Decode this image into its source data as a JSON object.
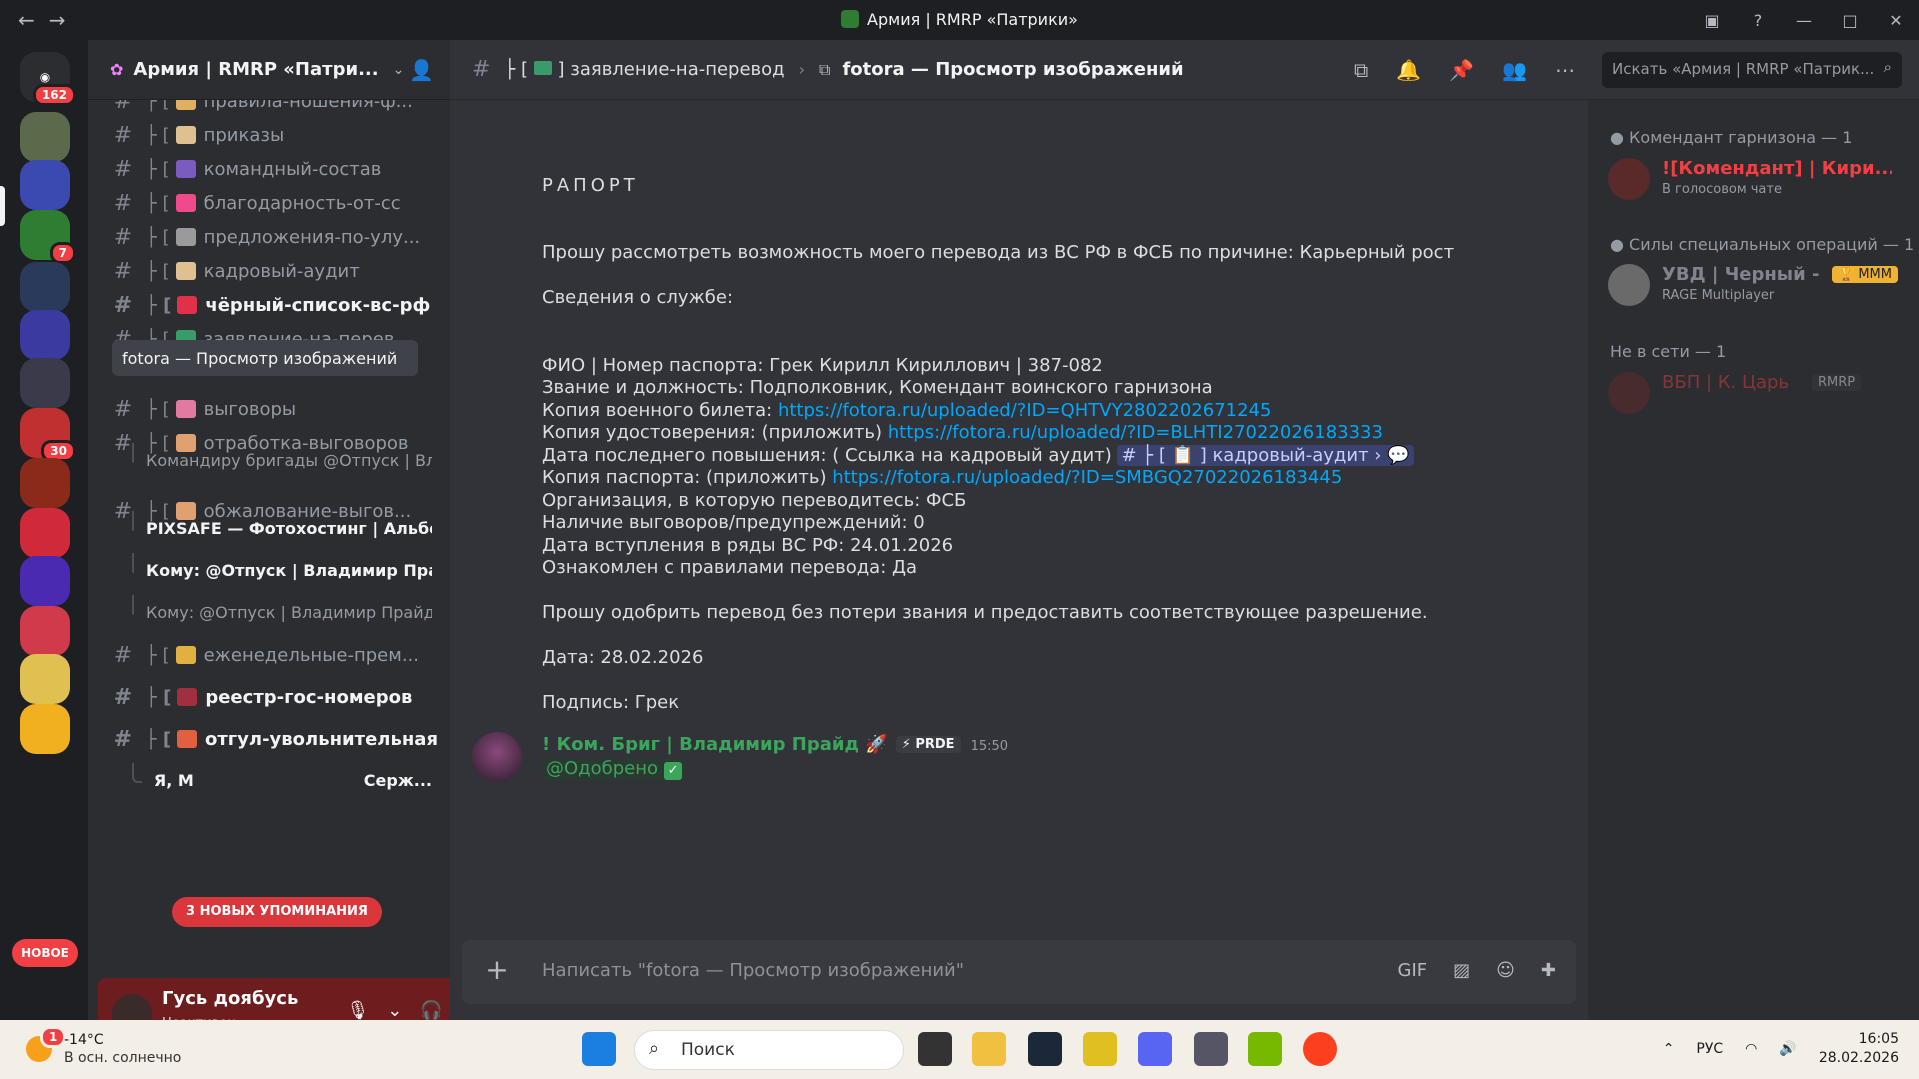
{
  "window": {
    "title": "Армия | RMRP «Патрики»"
  },
  "guilds": {
    "home_badge": "162",
    "badges": [
      "7",
      "30"
    ],
    "new_label": "НОВОЕ"
  },
  "server": {
    "name": "Армия | RMRP «Патри...",
    "mention_pill": "3 НОВЫХ УПОМИНАНИЯ"
  },
  "channels": [
    {
      "label": "правила-ношения-ф...",
      "emoji_color": "#e0b060"
    },
    {
      "label": "приказы",
      "emoji_color": "#e0c090"
    },
    {
      "label": "командный-состав",
      "emoji_color": "#7a5cc0"
    },
    {
      "label": "благодарность-от-сс",
      "emoji_color": "#f04a8a"
    },
    {
      "label": "предложения-по-улу...",
      "emoji_color": "#9a9a9a"
    },
    {
      "label": "кадровый-аудит",
      "emoji_color": "#e0c090"
    },
    {
      "label": "чёрный-список-вс-рф",
      "emoji_color": "#e0304a"
    },
    {
      "label": "заявление-на-перев...",
      "emoji_color": "#3a9a6a"
    },
    {
      "label": "выговоры",
      "emoji_color": "#e07aa0"
    },
    {
      "label": "отработка-выговоров",
      "emoji_color": "#e0a070"
    },
    {
      "label": "обжалование-выгов...",
      "emoji_color": "#e0a070"
    },
    {
      "label": "еженедельные-прем...",
      "emoji_color": "#e0b040"
    },
    {
      "label": "реестр-гос-номеров",
      "emoji_color": "#a03040"
    },
    {
      "label": "отгул-увольнительная",
      "emoji_color": "#e06040"
    }
  ],
  "threads": [
    {
      "label": "fotora — Просмотр изображений"
    },
    {
      "label": "Командиру бригады @Отпуск | Вл..."
    },
    {
      "label": "PIXSAFE — Фотохостинг | Альбом ..."
    },
    {
      "label": "Кому: @Отпуск | Владимир Прайд ..."
    },
    {
      "label": "Кому: @Отпуск | Владимир Прайд ..."
    },
    {
      "label": "Я, М"
    },
    {
      "label": "Серж..."
    }
  ],
  "channel_prefix": "├ [",
  "channel_suffix": "]",
  "user": {
    "name": "Гусь доябусь",
    "status": "Неактивен"
  },
  "header": {
    "channel": "заявление-на-перевод",
    "current": "fotora — Просмотр изображений",
    "search_placeholder": "Искать «Армия | RMRP «Патрик..."
  },
  "message": {
    "rapport": "РАПОРТ",
    "request": "Прошу рассмотреть возможность моего перевода из ВС РФ в ФСБ по причине: Карьерный рост",
    "service_info": "Сведения о службе:",
    "fio": "ФИО | Номер паспорта: Грек Кирилл Кириллович | 387-082",
    "rank": "Звание и должность: Подполковник, Комендант воинского гарнизона",
    "military_id_label": "Копия военного билета: ",
    "military_id_link": "https://fotora.ru/uploaded/?ID=QHTVY2802202671245",
    "cert_label": "Копия удостоверения: (приложить) ",
    "cert_link": "https://fotora.ru/uploaded/?ID=BLHTI27022026183333",
    "promo_label": "Дата последнего повышения: ( Ссылка на кадровый аудит) ",
    "promo_mention": "# ├ [ 📋 ] кадровый-аудит › 💬",
    "passport_label": "Копия паспорта: (приложить) ",
    "passport_link": "https://fotora.ru/uploaded/?ID=SMBGQ27022026183445",
    "org": "Организация, в которую переводитесь: ФСБ",
    "reprimands": "Наличие выговоров/предупреждений: 0",
    "joined": "Дата вступления в ряды ВС РФ:  24.01.2026",
    "rules": "Ознакомлен с правилами перевода:  Да",
    "approve_req": "Прошу одобрить перевод без потери звания и предоставить соответствующее разрешение.",
    "date": "Дата:  28.02.2026",
    "signature": "Подпись: Грек"
  },
  "reply": {
    "author": "! Ком. Бриг | Владимир Прайд 🚀",
    "tag": "⚡ PRDE",
    "time": "15:50",
    "text": "@Одобрено"
  },
  "composer": {
    "placeholder": "Написать \"fotora — Просмотр изображений\""
  },
  "members": {
    "groups": [
      "Комендант гарнизона — 1",
      "Силы специальных операций — 1",
      "Не в сети — 1"
    ],
    "list": [
      {
        "name": "![Комендант] | Кири...",
        "status": "В голосовом чате",
        "color": "#f23f43"
      },
      {
        "name": "УВД | Черный - ...",
        "status": "RAGE Multiplayer",
        "color": "#80848e",
        "tag": "🏆 MMM"
      },
      {
        "name": "ВБП | К. Царь",
        "status": "",
        "color": "#6a2a2a",
        "tag": "RMRP"
      }
    ]
  },
  "taskbar": {
    "weather_temp": "-14°C",
    "weather_desc": "В осн. солнечно",
    "weather_badge": "1",
    "search": "Поиск",
    "lang": "РУС",
    "time": "16:05",
    "date": "28.02.2026"
  }
}
